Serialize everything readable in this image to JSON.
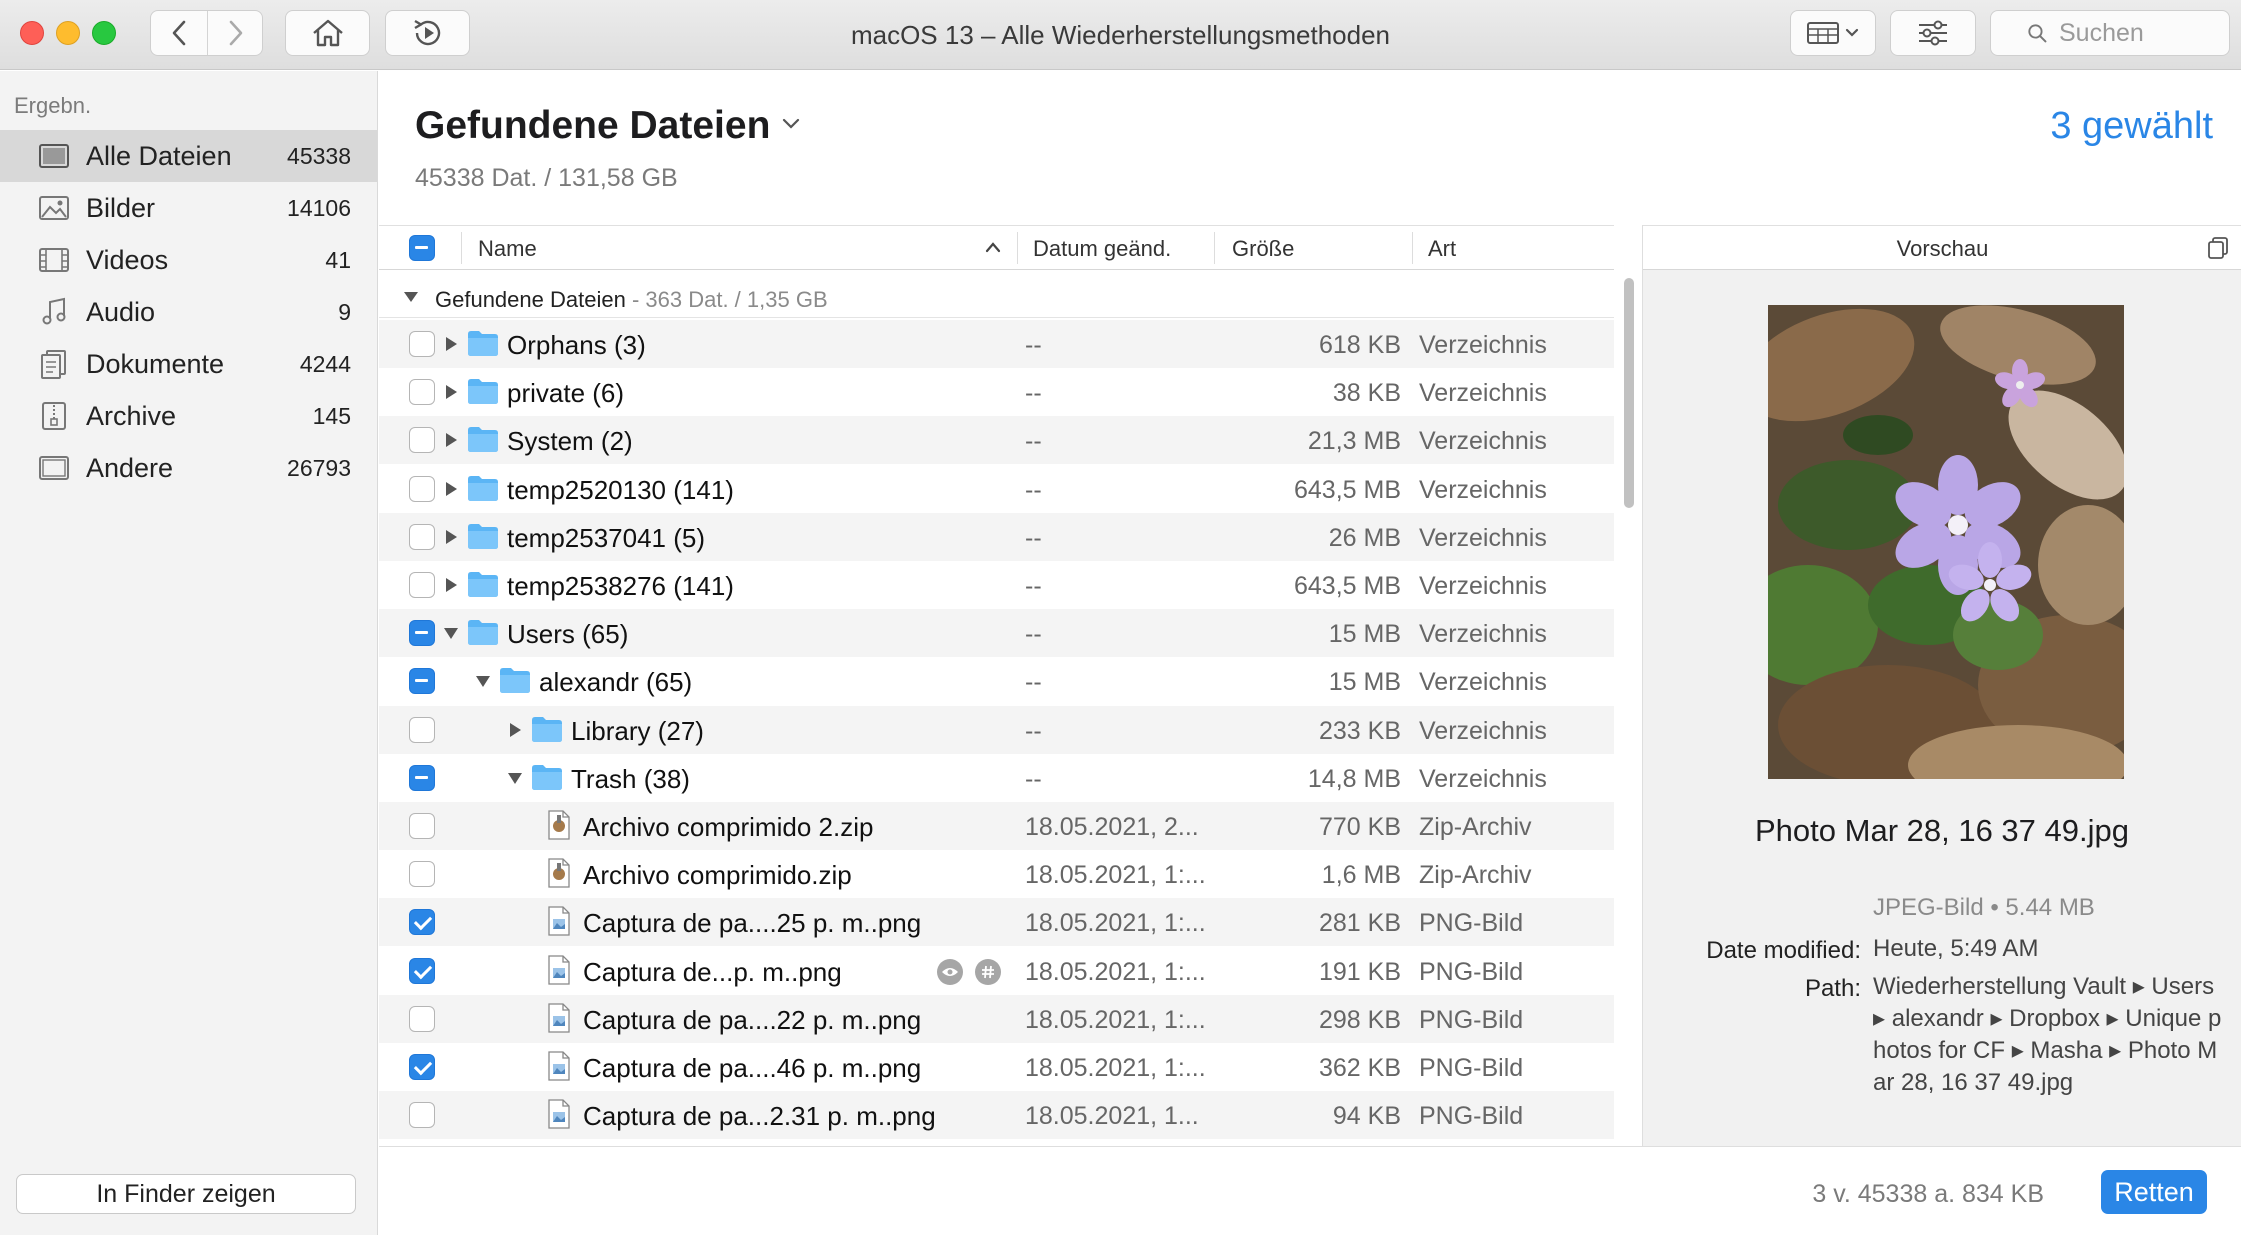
{
  "window": {
    "title": "macOS 13 – Alle Wiederherstellungsmethoden"
  },
  "toolbar": {
    "back_icon": "chevron-left-icon",
    "forward_icon": "chevron-right-icon",
    "home_icon": "home-icon",
    "history_icon": "clock-play-icon",
    "view_icon": "view-options-icon",
    "filter_icon": "sliders-icon",
    "search_placeholder": "Suchen"
  },
  "sidebar": {
    "heading": "Ergebn.",
    "items": [
      {
        "label": "Alle Dateien",
        "count": "45338",
        "icon": "all-files-icon",
        "active": true
      },
      {
        "label": "Bilder",
        "count": "14106",
        "icon": "images-icon"
      },
      {
        "label": "Videos",
        "count": "41",
        "icon": "video-icon"
      },
      {
        "label": "Audio",
        "count": "9",
        "icon": "music-icon"
      },
      {
        "label": "Dokumente",
        "count": "4244",
        "icon": "documents-icon"
      },
      {
        "label": "Archive",
        "count": "145",
        "icon": "archive-icon"
      },
      {
        "label": "Andere",
        "count": "26793",
        "icon": "other-files-icon"
      }
    ],
    "finder_button": "In Finder zeigen"
  },
  "header": {
    "title": "Gefundene Dateien",
    "subtitle": "45338 Dat. / 131,58 GB",
    "selected": "3 gewählt"
  },
  "table": {
    "columns": {
      "name": "Name",
      "date": "Datum geänd.",
      "size": "Größe",
      "kind": "Art"
    },
    "group": {
      "label": "Gefundene Dateien",
      "meta": "- 363 Dat. / 1,35 GB"
    },
    "rows": [
      {
        "name": "Orphans (3)",
        "date": "--",
        "size": "618 KB",
        "kind": "Verzeichnis",
        "type": "folder",
        "level": 0,
        "expanded": false,
        "check": "off"
      },
      {
        "name": "private (6)",
        "date": "--",
        "size": "38 KB",
        "kind": "Verzeichnis",
        "type": "folder",
        "level": 0,
        "expanded": false,
        "check": "off"
      },
      {
        "name": "System (2)",
        "date": "--",
        "size": "21,3 MB",
        "kind": "Verzeichnis",
        "type": "folder",
        "level": 0,
        "expanded": false,
        "check": "off"
      },
      {
        "name": "temp2520130 (141)",
        "date": "--",
        "size": "643,5 MB",
        "kind": "Verzeichnis",
        "type": "folder",
        "level": 0,
        "expanded": false,
        "check": "off"
      },
      {
        "name": "temp2537041 (5)",
        "date": "--",
        "size": "26 MB",
        "kind": "Verzeichnis",
        "type": "folder",
        "level": 0,
        "expanded": false,
        "check": "off"
      },
      {
        "name": "temp2538276 (141)",
        "date": "--",
        "size": "643,5 MB",
        "kind": "Verzeichnis",
        "type": "folder",
        "level": 0,
        "expanded": false,
        "check": "off"
      },
      {
        "name": "Users (65)",
        "date": "--",
        "size": "15 MB",
        "kind": "Verzeichnis",
        "type": "folder",
        "level": 0,
        "expanded": true,
        "check": "mixed"
      },
      {
        "name": "alexandr (65)",
        "date": "--",
        "size": "15 MB",
        "kind": "Verzeichnis",
        "type": "folder",
        "level": 1,
        "expanded": true,
        "check": "mixed"
      },
      {
        "name": "Library (27)",
        "date": "--",
        "size": "233 KB",
        "kind": "Verzeichnis",
        "type": "folder",
        "level": 2,
        "expanded": false,
        "check": "off"
      },
      {
        "name": "Trash (38)",
        "date": "--",
        "size": "14,8 MB",
        "kind": "Verzeichnis",
        "type": "folder",
        "level": 2,
        "expanded": true,
        "check": "mixed"
      },
      {
        "name": "Archivo comprimido 2.zip",
        "date": "18.05.2021, 2...",
        "size": "770 KB",
        "kind": "Zip-Archiv",
        "type": "zip",
        "level": 3,
        "check": "off"
      },
      {
        "name": "Archivo comprimido.zip",
        "date": "18.05.2021, 1:...",
        "size": "1,6 MB",
        "kind": "Zip-Archiv",
        "type": "zip",
        "level": 3,
        "check": "off"
      },
      {
        "name": "Captura de pa....25 p. m..png",
        "date": "18.05.2021, 1:...",
        "size": "281 KB",
        "kind": "PNG-Bild",
        "type": "png",
        "level": 3,
        "check": "on"
      },
      {
        "name": "Captura de...p. m..png",
        "date": "18.05.2021, 1:...",
        "size": "191 KB",
        "kind": "PNG-Bild",
        "type": "png",
        "level": 3,
        "check": "on",
        "actions": [
          "eye-icon",
          "hash-icon"
        ]
      },
      {
        "name": "Captura de pa....22 p. m..png",
        "date": "18.05.2021, 1:...",
        "size": "298 KB",
        "kind": "PNG-Bild",
        "type": "png",
        "level": 3,
        "check": "off"
      },
      {
        "name": "Captura de pa....46 p. m..png",
        "date": "18.05.2021, 1:...",
        "size": "362 KB",
        "kind": "PNG-Bild",
        "type": "png",
        "level": 3,
        "check": "on"
      },
      {
        "name": "Captura de pa...2.31 p. m..png",
        "date": "18.05.2021, 1...",
        "size": "94 KB",
        "kind": "PNG-Bild",
        "type": "png",
        "level": 3,
        "check": "off"
      }
    ]
  },
  "preview": {
    "title": "Vorschau",
    "file_name": "Photo Mar 28, 16 37 49.jpg",
    "file_type": "JPEG-Bild • 5.44 MB",
    "modified_label": "Date modified:",
    "modified_value": "Heute, 5:49 AM",
    "path_label": "Path:",
    "path_value": "Wiederherstellung Vault ▸ Users ▸ alexandr ▸ Dropbox ▸ Unique photos for CF ▸ Masha ▸ Photo Mar 28, 16 37 49.jpg"
  },
  "footer": {
    "status": "3 v. 45338 a. 834 KB",
    "recover_button": "Retten"
  },
  "colors": {
    "accent": "#2a86e6",
    "folder": "#5bb5f5",
    "selection": "#d8d8d8"
  }
}
